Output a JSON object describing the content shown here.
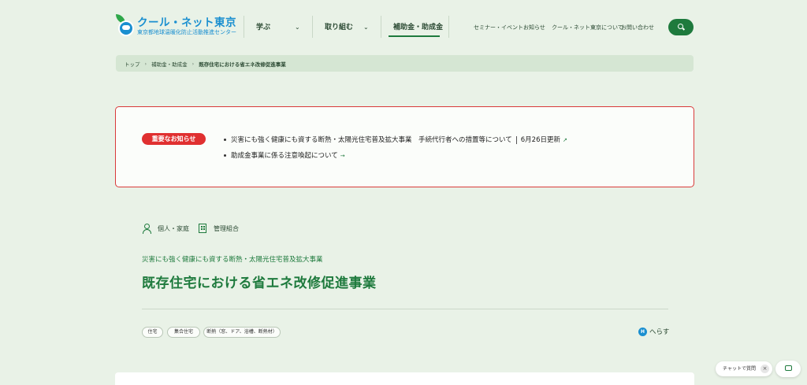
{
  "header": {
    "logo_title": "クール・ネット東京",
    "logo_subtitle": "東京都地球温暖化防止活動推進センター",
    "nav": [
      {
        "label": "学ぶ"
      },
      {
        "label": "取り組む"
      },
      {
        "label": "補助金・助成金"
      }
    ],
    "chevron": "⌄",
    "util_links": [
      "セミナー・イベント",
      "お知らせ",
      "クール・ネット東京について",
      "お問い合わせ"
    ],
    "search_icon": "search-icon",
    "accent_color": "#1e7a3d"
  },
  "breadcrumb": {
    "items": [
      "トップ",
      "補助金・助成金",
      "既存住宅における省エネ改修促進事業"
    ],
    "separator": "›"
  },
  "notice": {
    "badge": "重要なお知らせ",
    "items": [
      {
        "text": "災害にも強く健康にも資する断熱・太陽光住宅普及拡大事業　手続代行者への措置等について",
        "update": "6月26日更新",
        "icon": "↗"
      },
      {
        "text": "助成金事業に係る注意喚起について",
        "icon": "→"
      }
    ],
    "border_color": "#d93a3a"
  },
  "targets": [
    "個人・家庭",
    "管理組合"
  ],
  "subtitle": "災害にも強く健康にも資する断熱・太陽光住宅普及拡大事業",
  "title": "既存住宅における省エネ改修促進事業",
  "tags": [
    "住宅",
    "集合住宅",
    "断熱（窓、ドア、浴槽、断熱材）"
  ],
  "herasu": {
    "icon_letter": "H",
    "label": "へらす"
  },
  "chat": {
    "label": "チャットで質問",
    "close": "×"
  }
}
